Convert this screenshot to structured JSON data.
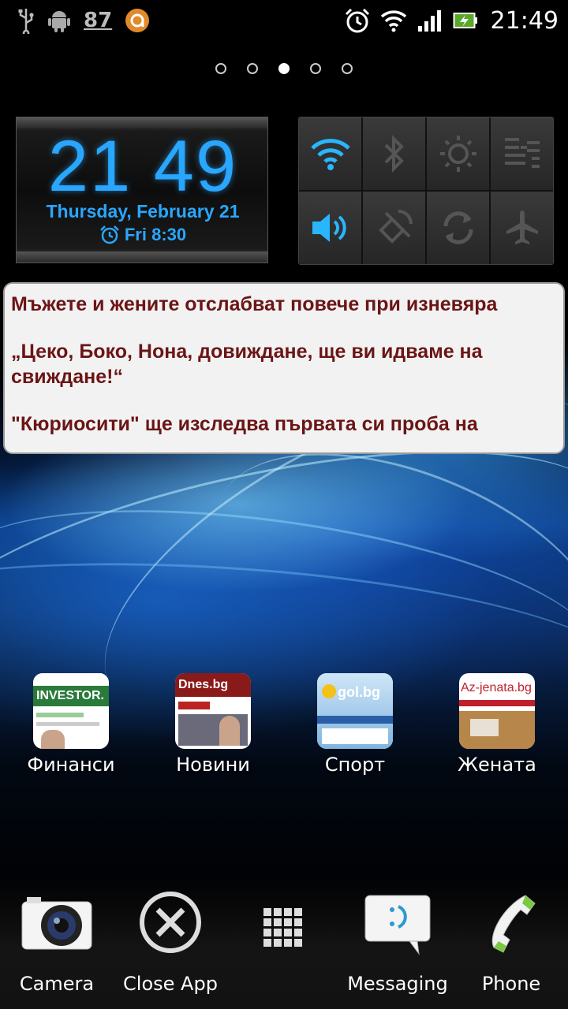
{
  "status_bar": {
    "left_icons": [
      "usb-icon",
      "android-debug-icon",
      "notification-count",
      "app-notification-icon"
    ],
    "notification_count": "87",
    "right_icons": [
      "alarm-icon",
      "wifi-icon",
      "signal-icon",
      "battery-charging-icon"
    ],
    "time": "21:49"
  },
  "pages": {
    "count": 5,
    "active_index": 2
  },
  "clock_widget": {
    "hours": "21",
    "minutes": "49",
    "date": "Thursday, February 21",
    "alarm": "Fri 8:30",
    "accent_color": "#29a7ff"
  },
  "toggles": [
    {
      "name": "wifi-icon",
      "active": true
    },
    {
      "name": "bluetooth-icon",
      "active": false
    },
    {
      "name": "brightness-icon",
      "active": false
    },
    {
      "name": "data-sync-icon",
      "active": false
    },
    {
      "name": "sound-icon",
      "active": true
    },
    {
      "name": "gps-icon",
      "active": false
    },
    {
      "name": "auto-rotate-icon",
      "active": false
    },
    {
      "name": "airplane-icon",
      "active": false
    }
  ],
  "news": {
    "headlines": [
      "Мъжете и жените отслабват повече при изневяра",
      "„Цеко, Боко, Нона, довиждане, ще ви идваме на свиждане!“",
      "\"Кюриосити\" ще изследва първата си проба на"
    ],
    "text_color": "#6b1515"
  },
  "apps": [
    {
      "label": "Финанси",
      "thumb_text": "INVESTOR."
    },
    {
      "label": "Новини",
      "thumb_text": "Dnes.bg"
    },
    {
      "label": "Спорт",
      "thumb_text": "gol.bg"
    },
    {
      "label": "Жената",
      "thumb_text": "Az-jenata.bg"
    }
  ],
  "dock": {
    "camera": "Camera",
    "close_app": "Close App",
    "apps_drawer": "",
    "messaging": "Messaging",
    "phone": "Phone"
  }
}
